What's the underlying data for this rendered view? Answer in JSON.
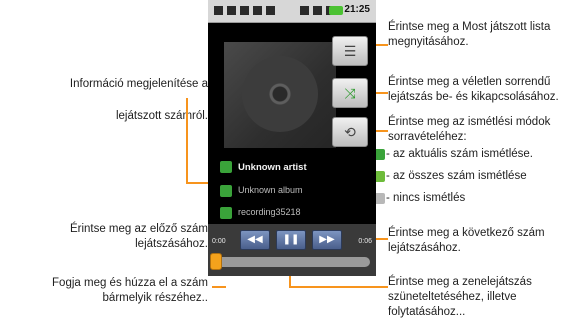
{
  "status_bar": {
    "time": "21:25"
  },
  "player": {
    "track_rows": [
      {
        "icon": "artist-icon",
        "text": "Unknown artist"
      },
      {
        "icon": "album-icon",
        "text": "Unknown album"
      },
      {
        "icon": "song-icon",
        "text": "recording35218"
      }
    ],
    "elapsed_time": "0:00",
    "total_time": "0:06",
    "buttons": {
      "playlist_icon": "list-icon",
      "shuffle_icon": "shuffle-icon",
      "repeat_icon": "repeat-icon",
      "prev_symbol": "◀◀",
      "pause_symbol": "❚❚",
      "next_symbol": "▶▶"
    },
    "progress": 0.0
  },
  "annotations": {
    "left": {
      "info": [
        "Információ megjelenítése a",
        "lejátszott számról."
      ],
      "prev": [
        "Érintse meg az előző szám",
        "lejátszásához."
      ],
      "drag": [
        "Fogja meg és húzza el a szám",
        "bármelyik részéhez.."
      ]
    },
    "right": {
      "playlist": [
        "Érintse meg a Most játszott lista",
        "megnyitásához."
      ],
      "shuffle": [
        "Érintse meg a véletlen sorrendű",
        "lejátszás be- és kikapcsolásához."
      ],
      "repeat": [
        "Érintse meg az ismétlési módok",
        "sorravételéhez:"
      ],
      "repeat_modes": [
        "- az aktuális szám ismétlése.",
        "- az összes szám ismétlése",
        "- nincs ismétlés"
      ],
      "next": [
        "Érintse meg a következő szám",
        "lejátszásához."
      ],
      "pause": [
        "Érintse meg a zenelejátszás",
        "szüneteltetéséhez, illetve",
        "folytatásához..."
      ]
    }
  },
  "colors": {
    "callout": "#f7941d",
    "accent_green": "#3aa33a",
    "control_blue": "#5a6f9c"
  }
}
